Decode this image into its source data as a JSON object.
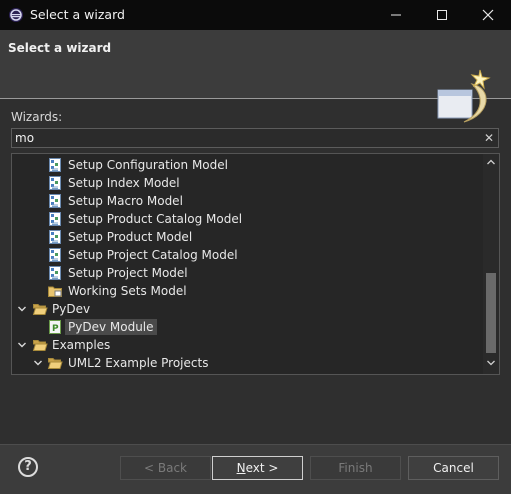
{
  "window": {
    "title": "Select a wizard"
  },
  "header": {
    "title": "Select a wizard"
  },
  "filter": {
    "label": "Wizards:",
    "value": "mo"
  },
  "tree": {
    "items": [
      {
        "label": "Setup Configuration Model",
        "icon": "setup-model-icon"
      },
      {
        "label": "Setup Index Model",
        "icon": "setup-model-icon"
      },
      {
        "label": "Setup Macro Model",
        "icon": "setup-model-icon"
      },
      {
        "label": "Setup Product Catalog Model",
        "icon": "setup-model-icon"
      },
      {
        "label": "Setup Product Model",
        "icon": "setup-model-icon"
      },
      {
        "label": "Setup Project Catalog Model",
        "icon": "setup-model-icon"
      },
      {
        "label": "Setup Project Model",
        "icon": "setup-model-icon"
      },
      {
        "label": "Working Sets Model",
        "icon": "folder-icon"
      },
      {
        "label": "PyDev",
        "icon": "folder-open-icon",
        "expanded": true
      },
      {
        "label": "PyDev Module",
        "icon": "pydev-module-icon",
        "selected": true
      },
      {
        "label": "Examples",
        "icon": "folder-open-icon",
        "expanded": true
      },
      {
        "label": "UML2 Example Projects",
        "icon": "folder-open-icon",
        "expanded": true
      }
    ]
  },
  "buttons": {
    "back": "< Back",
    "next_mnemonic": "N",
    "next_rest": "ext >",
    "finish": "Finish",
    "cancel": "Cancel"
  },
  "colors": {
    "background": "#2f2f2f",
    "titlebar": "#0b0b0b",
    "header": "#3c3c3c",
    "selection": "#4a4a4a"
  }
}
